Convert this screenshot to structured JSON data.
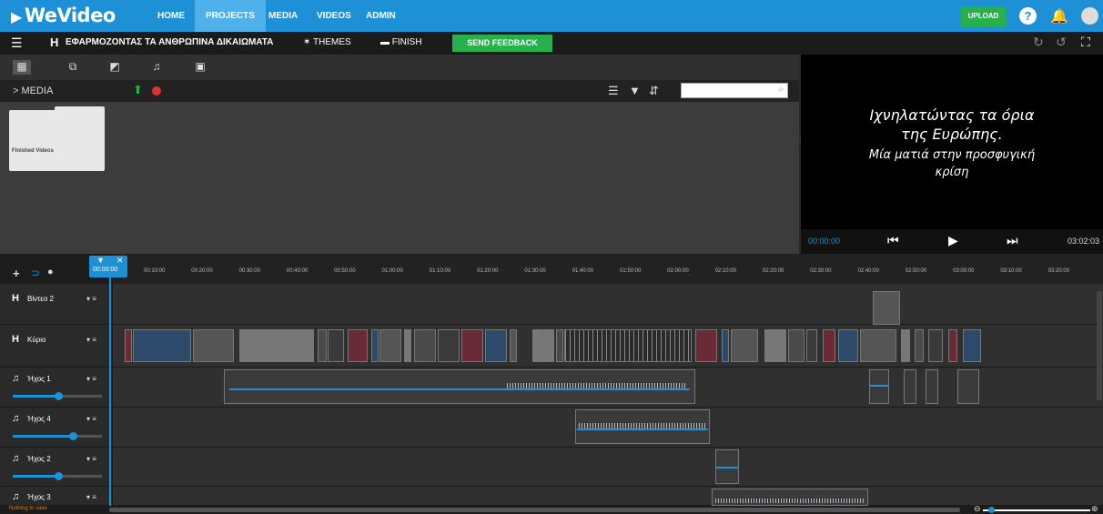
{
  "brand": {
    "logo": "WeVideo",
    "accent": "#1e90d6",
    "green": "#27b04c"
  },
  "topnav": {
    "items": [
      "HOME",
      "PROJECTS",
      "MEDIA",
      "VIDEOS",
      "ADMIN"
    ],
    "active": "PROJECTS",
    "upload_label": "UPLOAD",
    "help_label": "?"
  },
  "toolbar": {
    "project_title": "ΕΦΑΡΜΟΖΟΝΤΑΣ ΤΑ ΑΝΘΡΩΠΙΝΑ ΔΙΚΑΙΩΜΑΤΑ",
    "themes_label": "THEMES",
    "finish_label": "FINISH",
    "feedback_label": "SEND FEEDBACK"
  },
  "media": {
    "header_label": "> MEDIA",
    "search_placeholder": "",
    "folders": [
      {
        "name": "Finished Videos"
      }
    ]
  },
  "preview": {
    "line1": "Ιχνηλατώντας τα όρια",
    "line2": "της Ευρώπης.",
    "line3": "Μία ματιά στην προσφυγική",
    "line4": "κρίση",
    "current_time": "00:00:00",
    "total_time": "03:02:03"
  },
  "timeline": {
    "playhead_time": "00:00:00",
    "ticks": [
      "00:10:00",
      "00:20:00",
      "00:30:00",
      "00:40:00",
      "00:50:00",
      "01:00:00",
      "01:10:00",
      "01:20:00",
      "01:30:00",
      "01:40:00",
      "01:50:00",
      "02:00:00",
      "02:10:00",
      "02:20:00",
      "02:30:00",
      "02:40:00",
      "02:50:00",
      "03:00:00",
      "03:10:00",
      "03:20:00"
    ],
    "tracks": [
      {
        "name": "Βίντεο 2",
        "type": "video"
      },
      {
        "name": "Κύριο",
        "type": "video"
      },
      {
        "name": "Ήχος 1",
        "type": "audio"
      },
      {
        "name": "Ήχος 4",
        "type": "audio"
      },
      {
        "name": "Ήχος 2",
        "type": "audio"
      },
      {
        "name": "Ήχος 3",
        "type": "audio"
      }
    ]
  },
  "status": {
    "save_text": "Nothing to save"
  }
}
